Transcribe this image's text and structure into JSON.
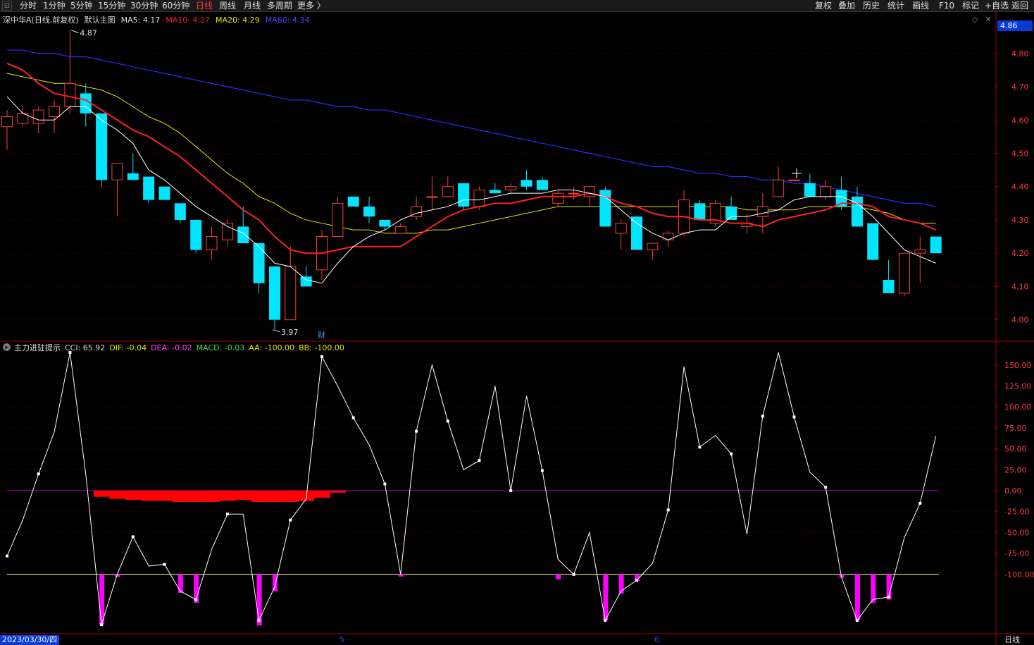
{
  "toolbar": {
    "tabs": [
      {
        "label": "分时",
        "active": false
      },
      {
        "label": "1分钟",
        "active": false
      },
      {
        "label": "5分钟",
        "active": false
      },
      {
        "label": "15分钟",
        "active": false
      },
      {
        "label": "30分钟",
        "active": false
      },
      {
        "label": "60分钟",
        "active": false
      },
      {
        "label": "日线",
        "active": true
      },
      {
        "label": "周线",
        "active": false
      },
      {
        "label": "月线",
        "active": false
      },
      {
        "label": "多周期",
        "active": false
      },
      {
        "label": "更多 〉",
        "active": false
      }
    ],
    "right_buttons": [
      "复权",
      "叠加",
      "历史",
      "统计",
      "画线",
      "F10",
      "标记",
      "+自选",
      "返回"
    ]
  },
  "main_header": {
    "stock_name": "深中华A(日线,前复权)",
    "template": "默认主图",
    "ma5": "MA5: 4.17",
    "ma10": "MA10: 4.27",
    "ma20": "MA20: 4.29",
    "ma60": "MA60: 4.34"
  },
  "current_price_tag": "4.86",
  "price_axis": [
    "4.80",
    "4.70",
    "4.60",
    "4.50",
    "4.40",
    "4.30",
    "4.20",
    "4.10",
    "4.00"
  ],
  "price_markers": {
    "high": "4.87",
    "low": "3.97"
  },
  "event_badge": "财",
  "indicator_header": {
    "name": "主力进驻提示",
    "cci": "CCI: 65.92",
    "dif": "DIF: -0.04",
    "dea": "DEA: -0.02",
    "macd": "MACD: -0.03",
    "aa": "AA: -100.00",
    "bb": "BB: -100.00"
  },
  "indicator_axis": [
    "150.00",
    "125.00",
    "100.00",
    "75.00",
    "50.00",
    "25.00",
    "0.00",
    "-25.00",
    "-50.00",
    "-75.00",
    "-100.00"
  ],
  "footer": {
    "date": "2023/03/30/四",
    "period": "日线",
    "month_marks": [
      "5",
      "6"
    ]
  },
  "colors": {
    "up": "#ff3c3c",
    "down": "#00e5ff",
    "ma5": "#ffffff",
    "ma10": "#ff2020",
    "ma20": "#e6e600",
    "ma60": "#2a2aff",
    "grid": "#6e0000",
    "axis": "#a00000",
    "cci": "#ffffff",
    "macd_bar": "#ff0000",
    "signal": "#ff00ff",
    "zero_line": "#c000c0",
    "neg100_line": "#ffffc0"
  },
  "chart_data": {
    "type": "candlestick",
    "price_ylim": [
      3.94,
      4.88
    ],
    "indicator_ylim": [
      -170,
      165
    ],
    "candles": [
      {
        "o": 4.58,
        "h": 4.63,
        "l": 4.51,
        "c": 4.61
      },
      {
        "o": 4.59,
        "h": 4.64,
        "l": 4.58,
        "c": 4.62
      },
      {
        "o": 4.59,
        "h": 4.64,
        "l": 4.56,
        "c": 4.63
      },
      {
        "o": 4.61,
        "h": 4.66,
        "l": 4.56,
        "c": 4.64
      },
      {
        "o": 4.64,
        "h": 4.87,
        "l": 4.62,
        "c": 4.71
      },
      {
        "o": 4.68,
        "h": 4.71,
        "l": 4.58,
        "c": 4.62
      },
      {
        "o": 4.62,
        "h": 4.62,
        "l": 4.4,
        "c": 4.42
      },
      {
        "o": 4.42,
        "h": 4.47,
        "l": 4.31,
        "c": 4.47
      },
      {
        "o": 4.44,
        "h": 4.5,
        "l": 4.43,
        "c": 4.42
      },
      {
        "o": 4.43,
        "h": 4.43,
        "l": 4.35,
        "c": 4.36
      },
      {
        "o": 4.4,
        "h": 4.4,
        "l": 4.36,
        "c": 4.36
      },
      {
        "o": 4.35,
        "h": 4.35,
        "l": 4.29,
        "c": 4.3
      },
      {
        "o": 4.3,
        "h": 4.3,
        "l": 4.2,
        "c": 4.21
      },
      {
        "o": 4.21,
        "h": 4.28,
        "l": 4.18,
        "c": 4.25
      },
      {
        "o": 4.24,
        "h": 4.3,
        "l": 4.22,
        "c": 4.29
      },
      {
        "o": 4.28,
        "h": 4.34,
        "l": 4.23,
        "c": 4.23
      },
      {
        "o": 4.23,
        "h": 4.23,
        "l": 4.08,
        "c": 4.11
      },
      {
        "o": 4.16,
        "h": 4.16,
        "l": 3.97,
        "c": 4.0
      },
      {
        "o": 4.0,
        "h": 4.22,
        "l": 4.0,
        "c": 4.16
      },
      {
        "o": 4.13,
        "h": 4.16,
        "l": 4.1,
        "c": 4.1
      },
      {
        "o": 4.15,
        "h": 4.27,
        "l": 4.12,
        "c": 4.25
      },
      {
        "o": 4.25,
        "h": 4.37,
        "l": 4.25,
        "c": 4.35
      },
      {
        "o": 4.37,
        "h": 4.37,
        "l": 4.34,
        "c": 4.34
      },
      {
        "o": 4.34,
        "h": 4.37,
        "l": 4.29,
        "c": 4.31
      },
      {
        "o": 4.3,
        "h": 4.3,
        "l": 4.27,
        "c": 4.28
      },
      {
        "o": 4.26,
        "h": 4.29,
        "l": 4.26,
        "c": 4.28
      },
      {
        "o": 4.31,
        "h": 4.37,
        "l": 4.3,
        "c": 4.34
      },
      {
        "o": 4.37,
        "h": 4.43,
        "l": 4.33,
        "c": 4.37
      },
      {
        "o": 4.37,
        "h": 4.43,
        "l": 4.37,
        "c": 4.4
      },
      {
        "o": 4.41,
        "h": 4.41,
        "l": 4.33,
        "c": 4.34
      },
      {
        "o": 4.34,
        "h": 4.4,
        "l": 4.33,
        "c": 4.39
      },
      {
        "o": 4.39,
        "h": 4.41,
        "l": 4.38,
        "c": 4.38
      },
      {
        "o": 4.39,
        "h": 4.41,
        "l": 4.38,
        "c": 4.4
      },
      {
        "o": 4.42,
        "h": 4.45,
        "l": 4.39,
        "c": 4.4
      },
      {
        "o": 4.42,
        "h": 4.43,
        "l": 4.39,
        "c": 4.39
      },
      {
        "o": 4.35,
        "h": 4.39,
        "l": 4.34,
        "c": 4.38
      },
      {
        "o": 4.38,
        "h": 4.4,
        "l": 4.36,
        "c": 4.38
      },
      {
        "o": 4.37,
        "h": 4.39,
        "l": 4.34,
        "c": 4.4
      },
      {
        "o": 4.39,
        "h": 4.4,
        "l": 4.28,
        "c": 4.28
      },
      {
        "o": 4.26,
        "h": 4.3,
        "l": 4.21,
        "c": 4.29
      },
      {
        "o": 4.31,
        "h": 4.31,
        "l": 4.21,
        "c": 4.21
      },
      {
        "o": 4.21,
        "h": 4.23,
        "l": 4.18,
        "c": 4.23
      },
      {
        "o": 4.24,
        "h": 4.27,
        "l": 4.22,
        "c": 4.26
      },
      {
        "o": 4.26,
        "h": 4.39,
        "l": 4.25,
        "c": 4.36
      },
      {
        "o": 4.35,
        "h": 4.36,
        "l": 4.3,
        "c": 4.3
      },
      {
        "o": 4.29,
        "h": 4.36,
        "l": 4.28,
        "c": 4.35
      },
      {
        "o": 4.34,
        "h": 4.37,
        "l": 4.3,
        "c": 4.3
      },
      {
        "o": 4.28,
        "h": 4.32,
        "l": 4.26,
        "c": 4.29
      },
      {
        "o": 4.31,
        "h": 4.38,
        "l": 4.26,
        "c": 4.34
      },
      {
        "o": 4.37,
        "h": 4.46,
        "l": 4.37,
        "c": 4.42
      },
      {
        "o": 4.42,
        "h": 4.42,
        "l": 4.42,
        "c": 4.42
      },
      {
        "o": 4.41,
        "h": 4.44,
        "l": 4.37,
        "c": 4.37
      },
      {
        "o": 4.37,
        "h": 4.42,
        "l": 4.36,
        "c": 4.4
      },
      {
        "o": 4.39,
        "h": 4.43,
        "l": 4.33,
        "c": 4.34
      },
      {
        "o": 4.37,
        "h": 4.4,
        "l": 4.28,
        "c": 4.28
      },
      {
        "o": 4.29,
        "h": 4.29,
        "l": 4.18,
        "c": 4.18
      },
      {
        "o": 4.12,
        "h": 4.18,
        "l": 4.08,
        "c": 4.08
      },
      {
        "o": 4.08,
        "h": 4.2,
        "l": 4.07,
        "c": 4.2
      },
      {
        "o": 4.2,
        "h": 4.25,
        "l": 4.11,
        "c": 4.21
      },
      {
        "o": 4.25,
        "h": 4.25,
        "l": 4.2,
        "c": 4.2
      }
    ],
    "ma5": [
      4.67,
      4.62,
      4.6,
      4.6,
      4.64,
      4.64,
      4.6,
      4.57,
      4.53,
      4.45,
      4.42,
      4.38,
      4.34,
      4.31,
      4.28,
      4.26,
      4.22,
      4.17,
      4.16,
      4.12,
      4.11,
      4.17,
      4.22,
      4.25,
      4.27,
      4.3,
      4.32,
      4.33,
      4.34,
      4.36,
      4.36,
      4.37,
      4.38,
      4.38,
      4.38,
      4.39,
      4.39,
      4.38,
      4.37,
      4.33,
      4.29,
      4.26,
      4.24,
      4.26,
      4.27,
      4.27,
      4.31,
      4.31,
      4.32,
      4.33,
      4.36,
      4.37,
      4.37,
      4.37,
      4.35,
      4.31,
      4.26,
      4.21,
      4.19,
      4.17
    ],
    "ma10": [
      4.77,
      4.75,
      4.71,
      4.68,
      4.67,
      4.66,
      4.63,
      4.6,
      4.57,
      4.55,
      4.52,
      4.49,
      4.45,
      4.41,
      4.37,
      4.33,
      4.3,
      4.25,
      4.21,
      4.2,
      4.2,
      4.21,
      4.22,
      4.22,
      4.22,
      4.22,
      4.25,
      4.28,
      4.31,
      4.33,
      4.34,
      4.35,
      4.35,
      4.36,
      4.37,
      4.37,
      4.37,
      4.38,
      4.37,
      4.35,
      4.34,
      4.32,
      4.31,
      4.31,
      4.3,
      4.3,
      4.29,
      4.29,
      4.28,
      4.3,
      4.31,
      4.32,
      4.33,
      4.35,
      4.35,
      4.34,
      4.31,
      4.3,
      4.29,
      4.27
    ],
    "ma20": [
      4.74,
      4.73,
      4.72,
      4.71,
      4.71,
      4.7,
      4.69,
      4.67,
      4.64,
      4.61,
      4.59,
      4.56,
      4.52,
      4.48,
      4.44,
      4.41,
      4.37,
      4.35,
      4.32,
      4.3,
      4.29,
      4.28,
      4.27,
      4.27,
      4.26,
      4.26,
      4.26,
      4.27,
      4.27,
      4.28,
      4.29,
      4.3,
      4.31,
      4.32,
      4.33,
      4.34,
      4.34,
      4.34,
      4.34,
      4.34,
      4.34,
      4.34,
      4.34,
      4.34,
      4.34,
      4.34,
      4.34,
      4.33,
      4.33,
      4.33,
      4.33,
      4.34,
      4.34,
      4.34,
      4.34,
      4.33,
      4.32,
      4.3,
      4.29,
      4.29
    ],
    "ma60": [
      4.81,
      4.81,
      4.8,
      4.8,
      4.79,
      4.79,
      4.78,
      4.77,
      4.76,
      4.75,
      4.74,
      4.73,
      4.72,
      4.71,
      4.7,
      4.69,
      4.68,
      4.67,
      4.66,
      4.66,
      4.65,
      4.64,
      4.64,
      4.63,
      4.63,
      4.62,
      4.61,
      4.6,
      4.59,
      4.58,
      4.57,
      4.56,
      4.55,
      4.54,
      4.53,
      4.52,
      4.51,
      4.5,
      4.49,
      4.48,
      4.47,
      4.46,
      4.46,
      4.45,
      4.44,
      4.44,
      4.43,
      4.43,
      4.42,
      4.42,
      4.41,
      4.41,
      4.4,
      4.39,
      4.38,
      4.37,
      4.36,
      4.35,
      4.35,
      4.34
    ],
    "cci": [
      -78,
      -35,
      20,
      70,
      165,
      20,
      -160,
      -100,
      -55,
      -90,
      -88,
      -120,
      -130,
      -70,
      -28,
      -28,
      -155,
      -115,
      -35,
      -10,
      160,
      125,
      87,
      55,
      8,
      -100,
      71,
      150,
      83,
      25,
      36,
      125,
      0,
      113,
      24,
      -82,
      -100,
      -50,
      -155,
      -120,
      -107,
      -87,
      -23,
      148,
      52,
      66,
      44,
      -52,
      89,
      165,
      88,
      22,
      4,
      -103,
      -155,
      -130,
      -127,
      -56,
      -15,
      65
    ],
    "macd_neg": [
      0,
      0,
      0,
      0,
      0,
      0,
      -0.006,
      -0.008,
      -0.009,
      -0.01,
      -0.01,
      -0.011,
      -0.011,
      -0.011,
      -0.01,
      -0.009,
      -0.011,
      -0.011,
      -0.011,
      -0.01,
      -0.007,
      -0.002,
      0,
      0,
      0,
      0,
      0,
      0,
      0,
      0,
      0,
      0,
      0,
      0,
      0,
      0,
      0,
      0,
      0,
      0,
      0,
      0,
      0,
      0,
      0,
      0,
      0,
      0,
      0,
      0,
      0,
      0,
      0,
      0,
      0,
      0,
      0,
      0,
      0,
      0
    ],
    "signal_bars": [
      0,
      0,
      0,
      0,
      0,
      0,
      -160,
      -103,
      0,
      0,
      0,
      -122,
      -134,
      0,
      0,
      0,
      -161,
      -120,
      0,
      0,
      0,
      0,
      0,
      0,
      0,
      -100,
      0,
      0,
      0,
      0,
      0,
      0,
      0,
      0,
      0,
      -106,
      0,
      0,
      -155,
      -123,
      -108,
      0,
      0,
      0,
      0,
      0,
      0,
      0,
      0,
      0,
      0,
      0,
      0,
      -104,
      -155,
      -134,
      -130,
      0,
      0,
      0
    ]
  }
}
